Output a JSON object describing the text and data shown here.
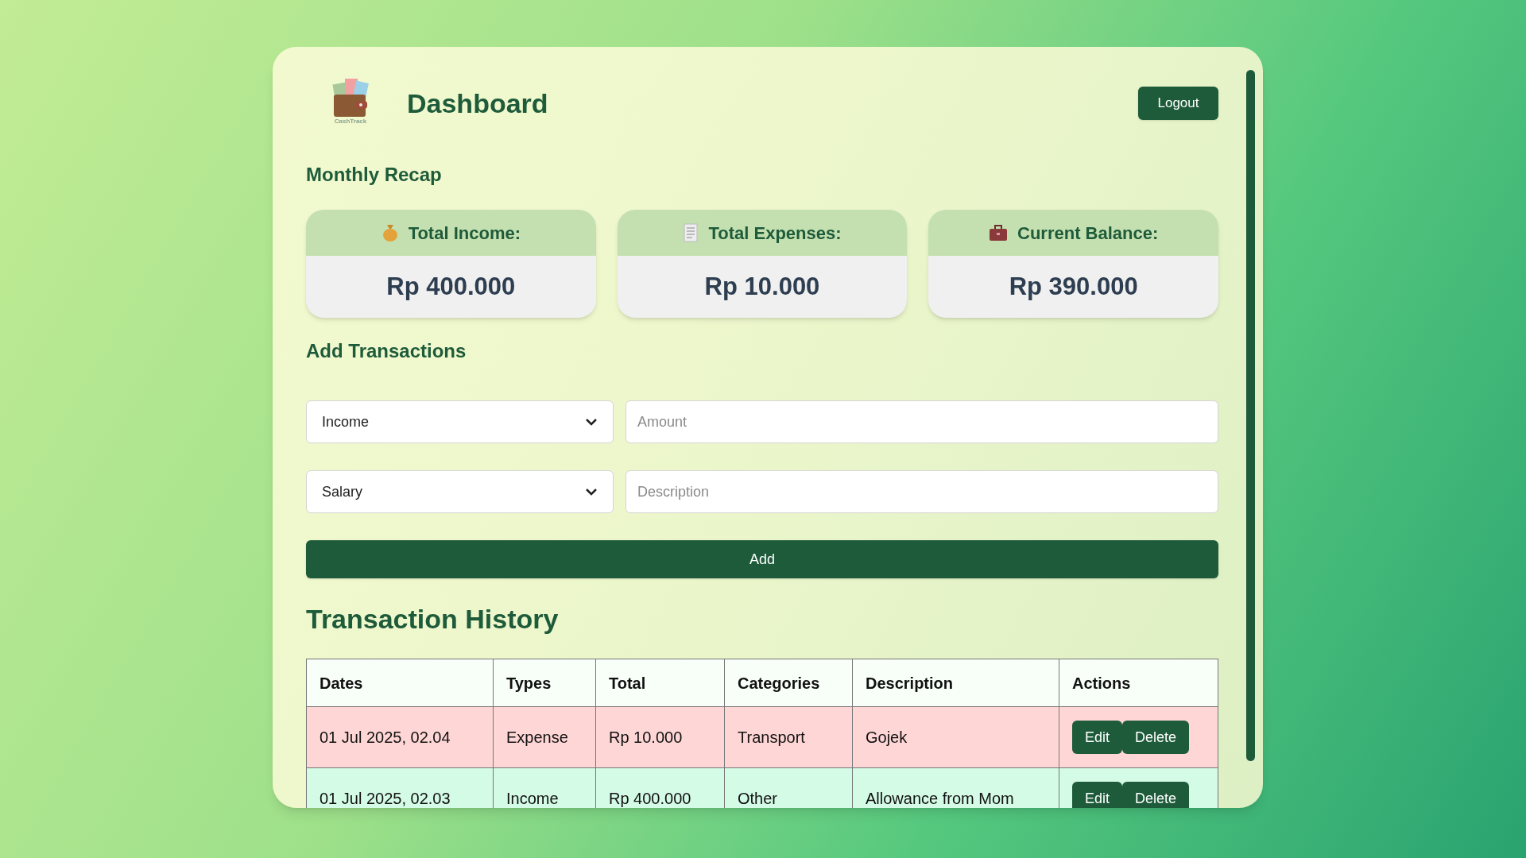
{
  "header": {
    "logo_text": "CashTrack",
    "title": "Dashboard",
    "logout": "Logout"
  },
  "recap": {
    "title": "Monthly Recap",
    "cards": [
      {
        "kind": "income",
        "label": "Total Income:",
        "value": "Rp 400.000"
      },
      {
        "kind": "expenses",
        "label": "Total Expenses:",
        "value": "Rp 10.000"
      },
      {
        "kind": "balance",
        "label": "Current Balance:",
        "value": "Rp 390.000"
      }
    ]
  },
  "add_form": {
    "title": "Add Transactions",
    "type_select": "Income",
    "amount": {
      "placeholder": "Amount"
    },
    "category_select": "Salary",
    "description": {
      "placeholder": "Description"
    },
    "submit": "Add"
  },
  "history": {
    "title": "Transaction History",
    "columns": [
      "Dates",
      "Types",
      "Total",
      "Categories",
      "Description",
      "Actions"
    ],
    "rows": [
      {
        "kind": "expense",
        "date": "01 Jul 2025, 02.04",
        "type": "Expense",
        "total": "Rp 10.000",
        "category": "Transport",
        "description": "Gojek",
        "actions": [
          "Edit",
          "Delete"
        ]
      },
      {
        "kind": "income",
        "date": "01 Jul 2025, 02.03",
        "type": "Income",
        "total": "Rp 400.000",
        "category": "Other",
        "description": "Allowance from Mom",
        "actions": [
          "Edit",
          "Delete"
        ]
      }
    ]
  }
}
